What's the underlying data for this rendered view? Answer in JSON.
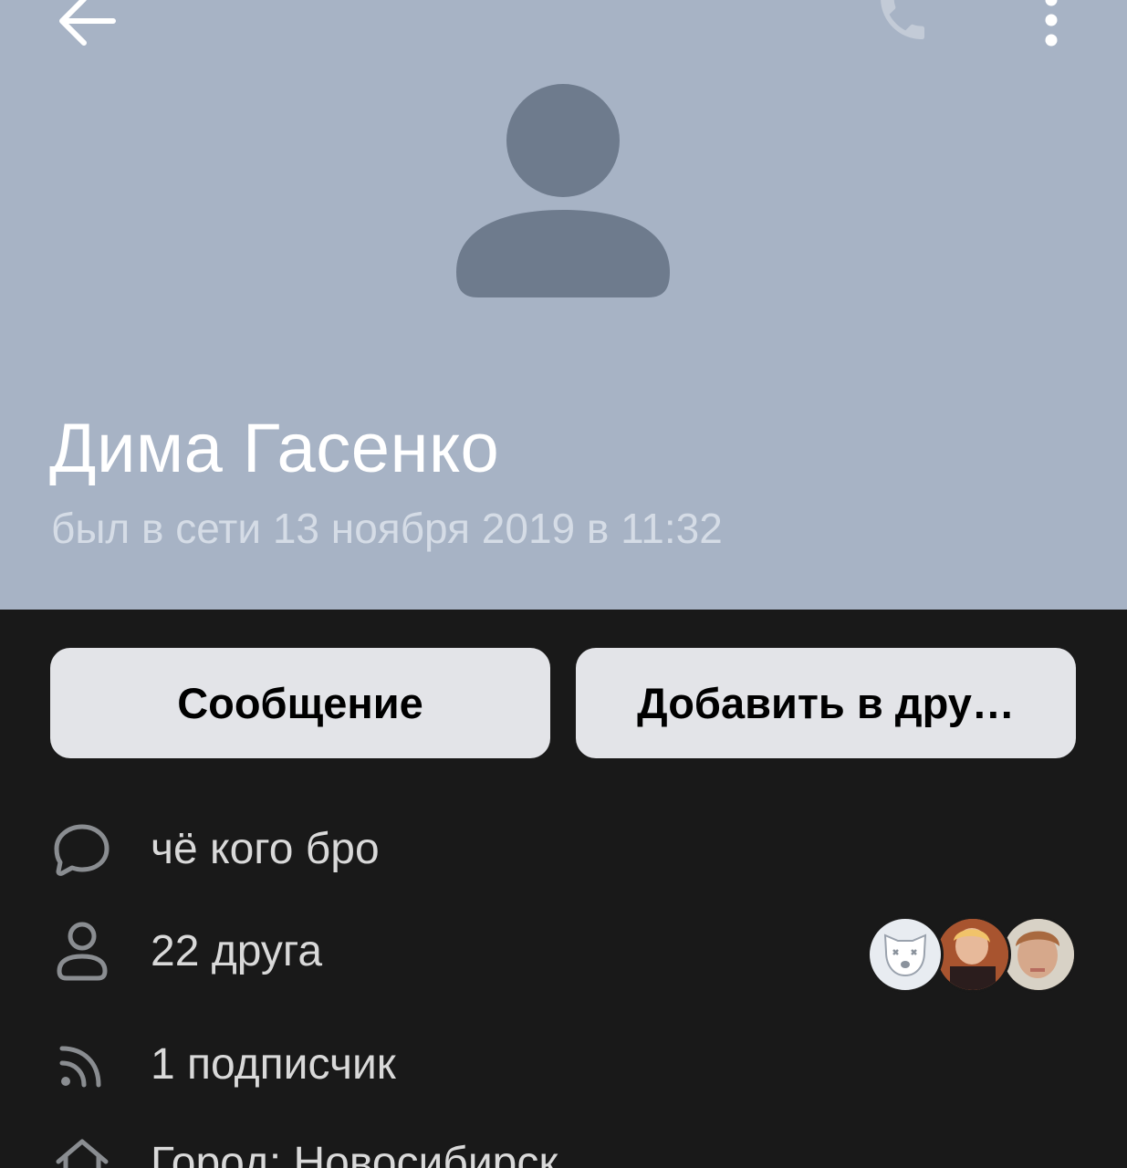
{
  "profile": {
    "name": "Дима Гасенко",
    "last_seen": "был в сети 13 ноября 2019 в 11:32"
  },
  "actions": {
    "message_label": "Сообщение",
    "add_friend_label": "Добавить в дру…"
  },
  "info": {
    "status_text": "чё кого бро",
    "friends_text": "22 друга",
    "followers_text": "1 подписчик",
    "city_text": "Город: Новосибирск"
  },
  "icons": {
    "back": "back-arrow-icon",
    "call": "phone-icon",
    "more": "more-vertical-icon",
    "status": "speech-bubble-icon",
    "friends": "user-icon",
    "followers": "rss-feed-icon",
    "city": "home-icon"
  },
  "colors": {
    "header_bg": "#a7b3c5",
    "page_bg": "#191919",
    "button_bg": "#e3e4e8",
    "avatar_silhouette": "#6e7b8d"
  }
}
